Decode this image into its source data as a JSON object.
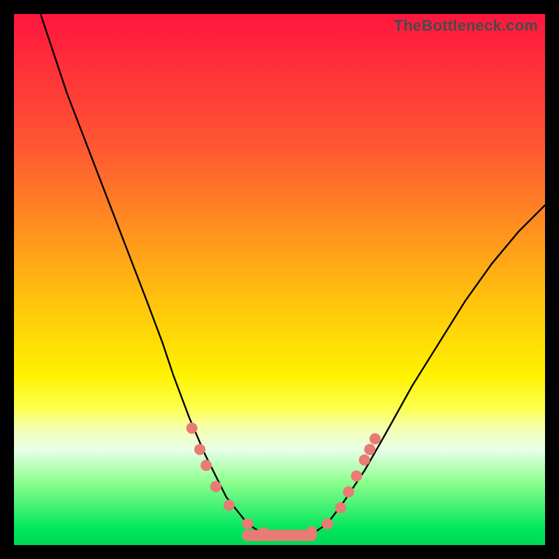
{
  "watermark": "TheBottleneck.com",
  "chart_data": {
    "type": "line",
    "title": "",
    "xlabel": "",
    "ylabel": "",
    "xlim": [
      0,
      100
    ],
    "ylim": [
      0,
      100
    ],
    "series": [
      {
        "name": "bottleneck-curve",
        "x": [
          5,
          10,
          15,
          20,
          25,
          28,
          30,
          33,
          36,
          40,
          44,
          47,
          50,
          53,
          56,
          59,
          62,
          66,
          70,
          75,
          80,
          85,
          90,
          95,
          100
        ],
        "values": [
          100,
          85,
          72,
          59,
          46,
          38,
          32,
          24,
          17,
          9,
          4,
          2,
          1,
          1,
          2,
          4,
          8,
          14,
          21,
          30,
          38,
          46,
          53,
          59,
          64
        ]
      }
    ],
    "markers": {
      "name": "highlighted-points",
      "color": "#e87b74",
      "points": [
        {
          "x": 33.5,
          "y": 22
        },
        {
          "x": 35.0,
          "y": 18
        },
        {
          "x": 36.2,
          "y": 15
        },
        {
          "x": 38.0,
          "y": 11
        },
        {
          "x": 40.5,
          "y": 7.5
        },
        {
          "x": 44.0,
          "y": 4
        },
        {
          "x": 47.0,
          "y": 2.3
        },
        {
          "x": 50.0,
          "y": 1.8
        },
        {
          "x": 53.0,
          "y": 1.8
        },
        {
          "x": 56.0,
          "y": 2.5
        },
        {
          "x": 59.0,
          "y": 4
        },
        {
          "x": 61.5,
          "y": 7
        },
        {
          "x": 63.0,
          "y": 10
        },
        {
          "x": 64.5,
          "y": 13
        },
        {
          "x": 66.0,
          "y": 16
        },
        {
          "x": 67.0,
          "y": 18
        },
        {
          "x": 68.0,
          "y": 20
        }
      ]
    },
    "flat_segment": {
      "name": "valley-bar",
      "color": "#e87b74",
      "x_start": 44,
      "x_end": 56,
      "y": 1.8
    },
    "gradient_stops": [
      {
        "pos": 0,
        "color": "#ff163f"
      },
      {
        "pos": 25,
        "color": "#ff5733"
      },
      {
        "pos": 55,
        "color": "#ffc60c"
      },
      {
        "pos": 70,
        "color": "#fff200"
      },
      {
        "pos": 88,
        "color": "#8fff8f"
      },
      {
        "pos": 100,
        "color": "#00d856"
      }
    ]
  }
}
